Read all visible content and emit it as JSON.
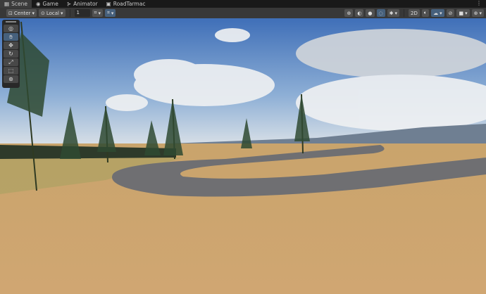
{
  "tabs": [
    {
      "label": "Scene",
      "icon": "grid-icon",
      "active": true
    },
    {
      "label": "Game",
      "icon": "gamepad-icon"
    },
    {
      "label": "Animator",
      "icon": "animator-icon"
    },
    {
      "label": "RoadTarmac",
      "icon": "prefab-icon"
    }
  ],
  "toolbar": {
    "pivot": "Center",
    "space": "Local",
    "grid_size": "1",
    "mode_2d": "2D"
  },
  "tools": [
    "view-tool",
    "hand-tool",
    "move-tool",
    "rotate-tool",
    "scale-tool",
    "rect-tool",
    "transform-tool"
  ],
  "colors": {
    "active": "#46607c",
    "panel": "#383838"
  }
}
